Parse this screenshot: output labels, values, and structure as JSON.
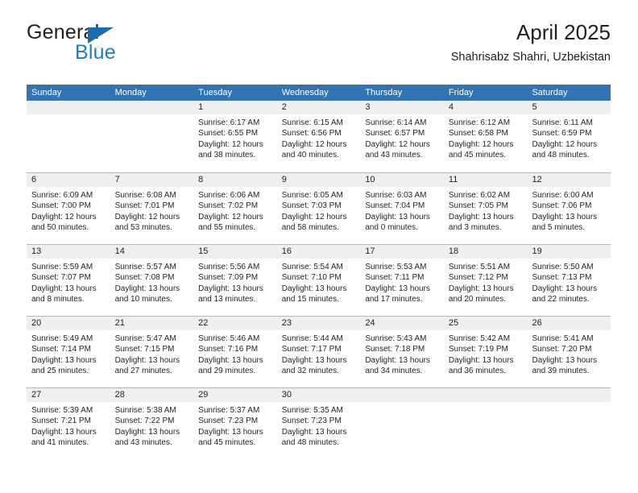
{
  "brand": {
    "name_top": "General",
    "name_bottom": "Blue",
    "triangle_color": "#1a6cb0",
    "blue_color": "#1b7ec4"
  },
  "header": {
    "title": "April 2025",
    "subtitle": "Shahrisabz Shahri, Uzbekistan"
  },
  "theme": {
    "header_bg": "#3273b4",
    "header_text": "#ffffff",
    "numband_bg": "#efefef",
    "grid_line": "#b8b8b8",
    "text": "#231f20"
  },
  "calendar": {
    "weekday_headers": [
      "Sunday",
      "Monday",
      "Tuesday",
      "Wednesday",
      "Thursday",
      "Friday",
      "Saturday"
    ],
    "weeks": [
      [
        {
          "day": "",
          "sunrise": "",
          "sunset": "",
          "daylight": "",
          "daylight2": ""
        },
        {
          "day": "",
          "sunrise": "",
          "sunset": "",
          "daylight": "",
          "daylight2": ""
        },
        {
          "day": "1",
          "sunrise": "Sunrise: 6:17 AM",
          "sunset": "Sunset: 6:55 PM",
          "daylight": "Daylight: 12 hours",
          "daylight2": "and 38 minutes."
        },
        {
          "day": "2",
          "sunrise": "Sunrise: 6:15 AM",
          "sunset": "Sunset: 6:56 PM",
          "daylight": "Daylight: 12 hours",
          "daylight2": "and 40 minutes."
        },
        {
          "day": "3",
          "sunrise": "Sunrise: 6:14 AM",
          "sunset": "Sunset: 6:57 PM",
          "daylight": "Daylight: 12 hours",
          "daylight2": "and 43 minutes."
        },
        {
          "day": "4",
          "sunrise": "Sunrise: 6:12 AM",
          "sunset": "Sunset: 6:58 PM",
          "daylight": "Daylight: 12 hours",
          "daylight2": "and 45 minutes."
        },
        {
          "day": "5",
          "sunrise": "Sunrise: 6:11 AM",
          "sunset": "Sunset: 6:59 PM",
          "daylight": "Daylight: 12 hours",
          "daylight2": "and 48 minutes."
        }
      ],
      [
        {
          "day": "6",
          "sunrise": "Sunrise: 6:09 AM",
          "sunset": "Sunset: 7:00 PM",
          "daylight": "Daylight: 12 hours",
          "daylight2": "and 50 minutes."
        },
        {
          "day": "7",
          "sunrise": "Sunrise: 6:08 AM",
          "sunset": "Sunset: 7:01 PM",
          "daylight": "Daylight: 12 hours",
          "daylight2": "and 53 minutes."
        },
        {
          "day": "8",
          "sunrise": "Sunrise: 6:06 AM",
          "sunset": "Sunset: 7:02 PM",
          "daylight": "Daylight: 12 hours",
          "daylight2": "and 55 minutes."
        },
        {
          "day": "9",
          "sunrise": "Sunrise: 6:05 AM",
          "sunset": "Sunset: 7:03 PM",
          "daylight": "Daylight: 12 hours",
          "daylight2": "and 58 minutes."
        },
        {
          "day": "10",
          "sunrise": "Sunrise: 6:03 AM",
          "sunset": "Sunset: 7:04 PM",
          "daylight": "Daylight: 13 hours",
          "daylight2": "and 0 minutes."
        },
        {
          "day": "11",
          "sunrise": "Sunrise: 6:02 AM",
          "sunset": "Sunset: 7:05 PM",
          "daylight": "Daylight: 13 hours",
          "daylight2": "and 3 minutes."
        },
        {
          "day": "12",
          "sunrise": "Sunrise: 6:00 AM",
          "sunset": "Sunset: 7:06 PM",
          "daylight": "Daylight: 13 hours",
          "daylight2": "and 5 minutes."
        }
      ],
      [
        {
          "day": "13",
          "sunrise": "Sunrise: 5:59 AM",
          "sunset": "Sunset: 7:07 PM",
          "daylight": "Daylight: 13 hours",
          "daylight2": "and 8 minutes."
        },
        {
          "day": "14",
          "sunrise": "Sunrise: 5:57 AM",
          "sunset": "Sunset: 7:08 PM",
          "daylight": "Daylight: 13 hours",
          "daylight2": "and 10 minutes."
        },
        {
          "day": "15",
          "sunrise": "Sunrise: 5:56 AM",
          "sunset": "Sunset: 7:09 PM",
          "daylight": "Daylight: 13 hours",
          "daylight2": "and 13 minutes."
        },
        {
          "day": "16",
          "sunrise": "Sunrise: 5:54 AM",
          "sunset": "Sunset: 7:10 PM",
          "daylight": "Daylight: 13 hours",
          "daylight2": "and 15 minutes."
        },
        {
          "day": "17",
          "sunrise": "Sunrise: 5:53 AM",
          "sunset": "Sunset: 7:11 PM",
          "daylight": "Daylight: 13 hours",
          "daylight2": "and 17 minutes."
        },
        {
          "day": "18",
          "sunrise": "Sunrise: 5:51 AM",
          "sunset": "Sunset: 7:12 PM",
          "daylight": "Daylight: 13 hours",
          "daylight2": "and 20 minutes."
        },
        {
          "day": "19",
          "sunrise": "Sunrise: 5:50 AM",
          "sunset": "Sunset: 7:13 PM",
          "daylight": "Daylight: 13 hours",
          "daylight2": "and 22 minutes."
        }
      ],
      [
        {
          "day": "20",
          "sunrise": "Sunrise: 5:49 AM",
          "sunset": "Sunset: 7:14 PM",
          "daylight": "Daylight: 13 hours",
          "daylight2": "and 25 minutes."
        },
        {
          "day": "21",
          "sunrise": "Sunrise: 5:47 AM",
          "sunset": "Sunset: 7:15 PM",
          "daylight": "Daylight: 13 hours",
          "daylight2": "and 27 minutes."
        },
        {
          "day": "22",
          "sunrise": "Sunrise: 5:46 AM",
          "sunset": "Sunset: 7:16 PM",
          "daylight": "Daylight: 13 hours",
          "daylight2": "and 29 minutes."
        },
        {
          "day": "23",
          "sunrise": "Sunrise: 5:44 AM",
          "sunset": "Sunset: 7:17 PM",
          "daylight": "Daylight: 13 hours",
          "daylight2": "and 32 minutes."
        },
        {
          "day": "24",
          "sunrise": "Sunrise: 5:43 AM",
          "sunset": "Sunset: 7:18 PM",
          "daylight": "Daylight: 13 hours",
          "daylight2": "and 34 minutes."
        },
        {
          "day": "25",
          "sunrise": "Sunrise: 5:42 AM",
          "sunset": "Sunset: 7:19 PM",
          "daylight": "Daylight: 13 hours",
          "daylight2": "and 36 minutes."
        },
        {
          "day": "26",
          "sunrise": "Sunrise: 5:41 AM",
          "sunset": "Sunset: 7:20 PM",
          "daylight": "Daylight: 13 hours",
          "daylight2": "and 39 minutes."
        }
      ],
      [
        {
          "day": "27",
          "sunrise": "Sunrise: 5:39 AM",
          "sunset": "Sunset: 7:21 PM",
          "daylight": "Daylight: 13 hours",
          "daylight2": "and 41 minutes."
        },
        {
          "day": "28",
          "sunrise": "Sunrise: 5:38 AM",
          "sunset": "Sunset: 7:22 PM",
          "daylight": "Daylight: 13 hours",
          "daylight2": "and 43 minutes."
        },
        {
          "day": "29",
          "sunrise": "Sunrise: 5:37 AM",
          "sunset": "Sunset: 7:23 PM",
          "daylight": "Daylight: 13 hours",
          "daylight2": "and 45 minutes."
        },
        {
          "day": "30",
          "sunrise": "Sunrise: 5:35 AM",
          "sunset": "Sunset: 7:23 PM",
          "daylight": "Daylight: 13 hours",
          "daylight2": "and 48 minutes."
        },
        {
          "day": "",
          "sunrise": "",
          "sunset": "",
          "daylight": "",
          "daylight2": ""
        },
        {
          "day": "",
          "sunrise": "",
          "sunset": "",
          "daylight": "",
          "daylight2": ""
        },
        {
          "day": "",
          "sunrise": "",
          "sunset": "",
          "daylight": "",
          "daylight2": ""
        }
      ]
    ]
  }
}
